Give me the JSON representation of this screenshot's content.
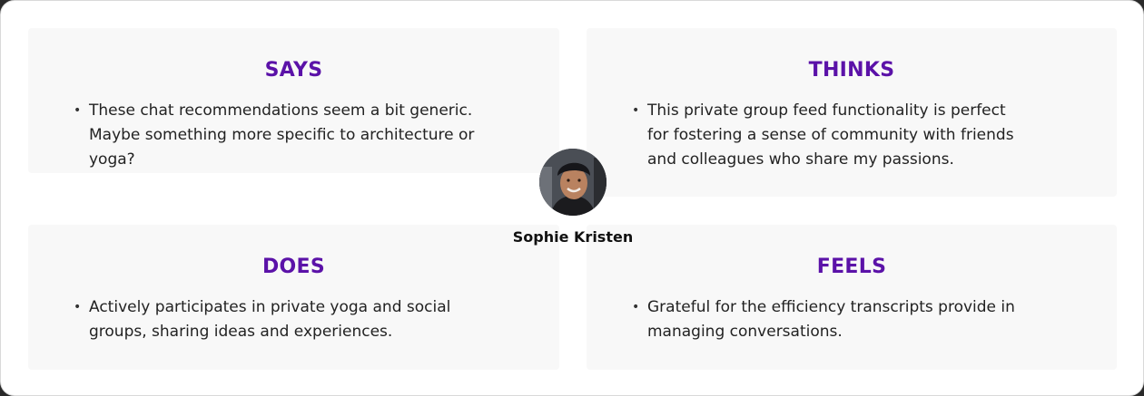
{
  "persona": {
    "name": "Sophie Kristen",
    "avatar_icon": "person-photo-avatar"
  },
  "colors": {
    "heading": "#5b12a8",
    "panel_bg": "#f8f8f8",
    "text": "#222222"
  },
  "quadrants": {
    "says": {
      "title": "SAYS",
      "items": [
        "These chat recommendations seem a bit generic. Maybe something more specific to architecture or yoga?"
      ]
    },
    "thinks": {
      "title": "THINKS",
      "items": [
        "This private group feed functionality is perfect for fostering a sense of community with friends and colleagues who share my passions."
      ]
    },
    "does": {
      "title": "DOES",
      "items": [
        "Actively participates in private yoga and social groups, sharing ideas and experiences."
      ]
    },
    "feels": {
      "title": "FEELS",
      "items": [
        "Grateful for the efficiency transcripts provide in managing conversations."
      ]
    }
  }
}
